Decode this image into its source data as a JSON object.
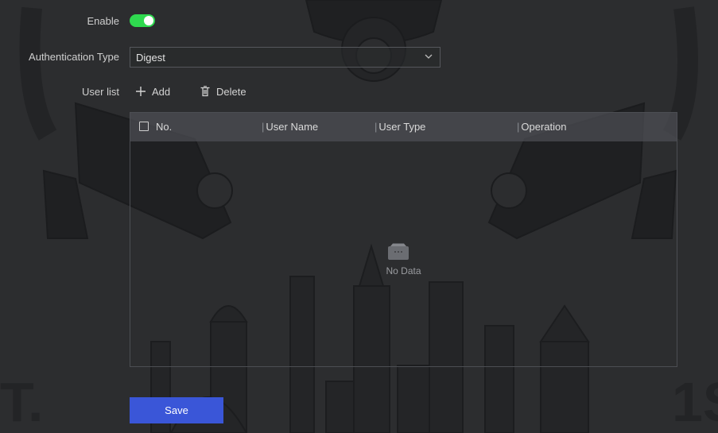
{
  "form": {
    "enable_label": "Enable",
    "enable_on": true,
    "auth_type_label": "Authentication Type",
    "auth_type_value": "Digest",
    "user_list_label": "User list"
  },
  "toolbar": {
    "add_label": "Add",
    "delete_label": "Delete"
  },
  "table": {
    "columns": [
      "No.",
      "User Name",
      "User Type",
      "Operation"
    ],
    "rows": [],
    "empty_text": "No Data"
  },
  "actions": {
    "save_label": "Save"
  },
  "colors": {
    "toggle_on": "#2fd94f",
    "primary_button": "#3a56d8",
    "background": "#2c2d2f"
  },
  "icons": {
    "add": "plus-icon",
    "delete": "trash-icon",
    "dropdown": "chevron-down-icon",
    "empty": "empty-box-icon"
  }
}
